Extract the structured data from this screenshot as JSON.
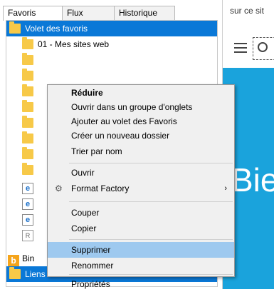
{
  "tabs": [
    "Favoris",
    "Flux",
    "Historique"
  ],
  "tree": {
    "selected_root": "Volet des favoris",
    "item1": "01 - Mes sites web",
    "item_bing": "Bin",
    "item_links": "Liens"
  },
  "right": {
    "site_text": "sur ce sit",
    "hero_text": "Bie"
  },
  "menu": {
    "collapse": "Réduire",
    "open_tab_group": "Ouvrir dans un groupe d'onglets",
    "add_to_bar": "Ajouter au volet des Favoris",
    "new_folder": "Créer un nouveau dossier",
    "sort_by_name": "Trier par nom",
    "open": "Ouvrir",
    "format_factory": "Format Factory",
    "cut": "Couper",
    "copy": "Copier",
    "delete": "Supprimer",
    "rename": "Renommer",
    "properties": "Propriétés"
  },
  "colors": {
    "selection": "#0a78d7",
    "menu_highlight": "#9ec9ef",
    "hero_blue": "#1aa3dc",
    "folder": "#f7c948"
  }
}
